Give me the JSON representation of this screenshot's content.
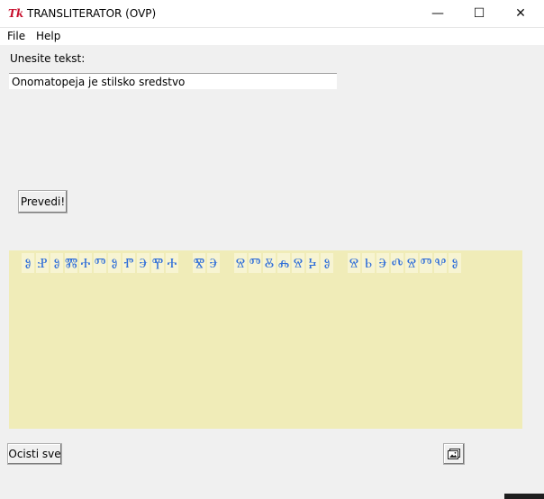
{
  "window": {
    "title": "TRANSLITERATOR (OVP)",
    "app_icon_glyph": "Tk",
    "minimize_glyph": "—",
    "maximize_glyph": "☐",
    "close_glyph": "✕"
  },
  "menu": {
    "items": [
      "File",
      "Help"
    ]
  },
  "form": {
    "label": "Unesite tekst:",
    "input_value": "Onomatopeja je stilsko sredstvo",
    "translate_button": "Prevedi!",
    "clear_button": "Ocisti sve"
  },
  "output": {
    "glyph_words": [
      [
        "ⰑⰐⰑⰏⰀⰕⰑⰒⰅⰉⰀ"
      ],
      [
        "ⰊⰅ"
      ],
      [
        "ⰔⰕⰋⰎⰔⰍⰑ"
      ],
      [
        "ⰔⰓⰅⰄⰔⰕⰂⰑ"
      ]
    ]
  },
  "colors": {
    "output_background": "#f0ecb8",
    "glyph_color": "#2f6ed8",
    "app_icon_color": "#c8102e"
  },
  "icons": {
    "save_image": "image-save-icon"
  }
}
